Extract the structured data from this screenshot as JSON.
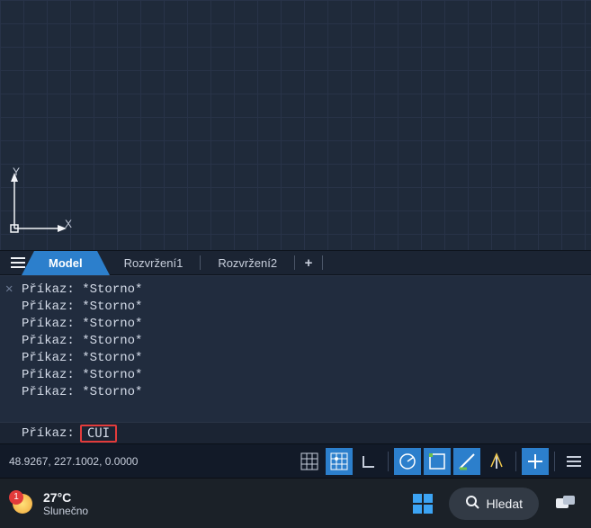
{
  "viewport": {
    "axis_y": "Y",
    "axis_x": "X"
  },
  "tabs": {
    "active": "Model",
    "items": [
      "Rozvržení1",
      "Rozvržení2"
    ],
    "add": "+"
  },
  "cli": {
    "history": [
      "Příkaz: *Storno*",
      "Příkaz: *Storno*",
      "Příkaz: *Storno*",
      "Příkaz: *Storno*",
      "Příkaz: *Storno*",
      "Příkaz: *Storno*",
      "Příkaz: *Storno*"
    ],
    "prompt": "Příkaz:",
    "value": "CUI"
  },
  "statusbar": {
    "coords": "48.9267, 227.1002, 0.0000"
  },
  "taskbar": {
    "badge": "1",
    "temp": "27°C",
    "desc": "Slunečno",
    "search": "Hledat"
  }
}
